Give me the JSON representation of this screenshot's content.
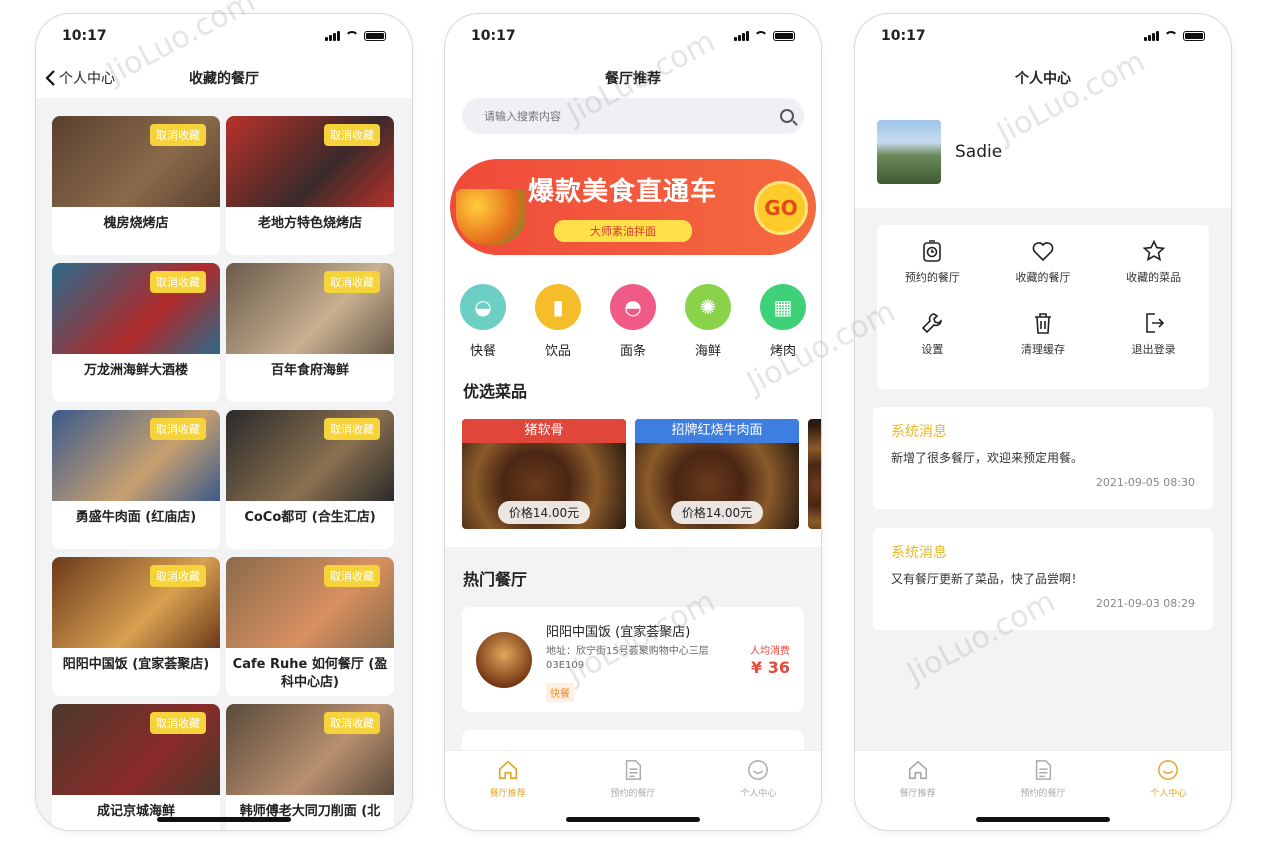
{
  "status": {
    "time": "10:17"
  },
  "screen1": {
    "back_label": "个人中心",
    "title": "收藏的餐厅",
    "unfavorite_label": "取消收藏",
    "restaurants": [
      {
        "name": "槐房烧烤店",
        "colors": [
          "#5a4030",
          "#8a6a4a"
        ]
      },
      {
        "name": "老地方特色烧烤店",
        "colors": [
          "#b8322a",
          "#3a2a2a"
        ]
      },
      {
        "name": "万龙洲海鲜大酒楼",
        "colors": [
          "#2a6a8a",
          "#b02a2a"
        ]
      },
      {
        "name": "百年食府海鲜",
        "colors": [
          "#6a5a4a",
          "#c8b090"
        ]
      },
      {
        "name": "勇盛牛肉面 (红庙店)",
        "colors": [
          "#3a5a8a",
          "#c8a070"
        ]
      },
      {
        "name": "CoCo都可 (合生汇店)",
        "colors": [
          "#2a2a2a",
          "#8a7050"
        ]
      },
      {
        "name": "阳阳中国饭 (宜家荟聚店)",
        "colors": [
          "#6a3a1a",
          "#d8a050"
        ]
      },
      {
        "name": "Cafe Ruhe 如何餐厅 (盈科中心店)",
        "colors": [
          "#8a6a4a",
          "#d89060"
        ]
      },
      {
        "name": "成记京城海鲜",
        "colors": [
          "#4a3a2a",
          "#8a2a2a"
        ]
      },
      {
        "name": "韩师傅老大同刀削面 (北",
        "colors": [
          "#5a4a3a",
          "#b89070"
        ]
      }
    ]
  },
  "screen2": {
    "title": "餐厅推荐",
    "search_placeholder": "请输入搜索内容",
    "banner_title": "爆款美食直通车",
    "banner_sub": "大师素油拌面",
    "banner_go": "GO",
    "categories": [
      {
        "label": "快餐",
        "icon": "bowl-icon",
        "color": "#6dcfc4"
      },
      {
        "label": "饮品",
        "icon": "drink-icon",
        "color": "#f6bd2a"
      },
      {
        "label": "面条",
        "icon": "noodle-icon",
        "color": "#ef5b86"
      },
      {
        "label": "海鲜",
        "icon": "crab-icon",
        "color": "#8ad24a"
      },
      {
        "label": "烤肉",
        "icon": "grill-icon",
        "color": "#3fd07a"
      }
    ],
    "featured_title": "优选菜品",
    "dishes": [
      {
        "name": "猪软骨",
        "price": "价格14.00元",
        "color": "#e0463a"
      },
      {
        "name": "招牌红烧牛肉面",
        "price": "价格14.00元",
        "color": "#3e7ee0"
      }
    ],
    "hot_title": "热门餐厅",
    "hot_restaurant": {
      "name": "阳阳中国饭 (宜家荟聚店)",
      "address": "地址：欣宁街15号荟聚购物中心三层03E109",
      "tag": "快餐",
      "avg_label": "人均消费",
      "avg_value": "¥ 36"
    },
    "tabs": [
      {
        "label": "餐厅推荐",
        "icon": "home-icon"
      },
      {
        "label": "预约的餐厅",
        "icon": "document-icon"
      },
      {
        "label": "个人中心",
        "icon": "smile-icon"
      }
    ],
    "active_tab_color": "#e0a52a"
  },
  "screen3": {
    "title": "个人中心",
    "username": "Sadie",
    "menu": [
      {
        "label": "预约的餐厅",
        "icon": "timer-icon"
      },
      {
        "label": "收藏的餐厅",
        "icon": "heart-icon"
      },
      {
        "label": "收藏的菜品",
        "icon": "star-icon"
      },
      {
        "label": "设置",
        "icon": "wrench-icon"
      },
      {
        "label": "清理缓存",
        "icon": "trash-icon"
      },
      {
        "label": "退出登录",
        "icon": "logout-icon"
      }
    ],
    "messages": [
      {
        "title": "系统消息",
        "body": "新增了很多餐厅，欢迎来预定用餐。",
        "date": "2021-09-05 08:30"
      },
      {
        "title": "系统消息",
        "body": "又有餐厅更新了菜品，快了品尝啊！",
        "date": "2021-09-03 08:29"
      }
    ],
    "tabs": [
      {
        "label": "餐厅推荐",
        "icon": "home-icon"
      },
      {
        "label": "预约的餐厅",
        "icon": "document-icon"
      },
      {
        "label": "个人中心",
        "icon": "smile-icon"
      }
    ]
  },
  "watermark": "JioLuo.com"
}
